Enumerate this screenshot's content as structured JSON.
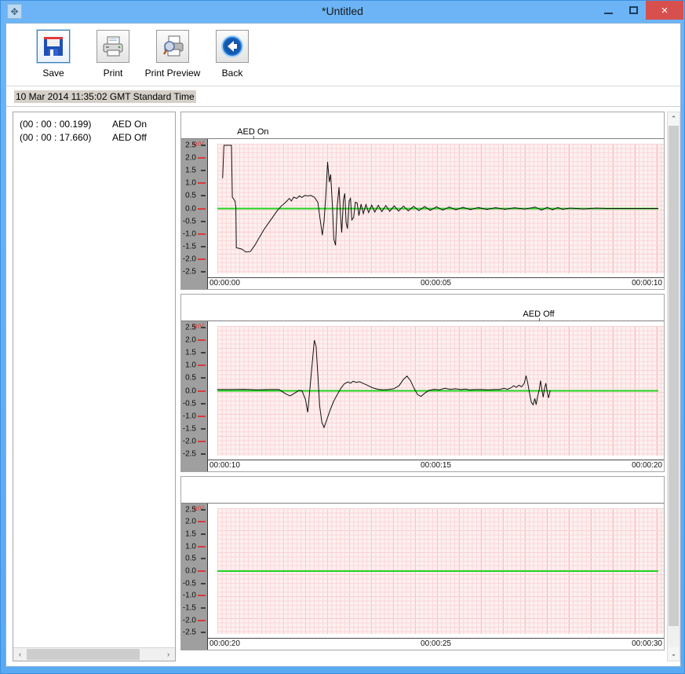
{
  "window": {
    "title": "*Untitled",
    "app_icon": "app-icon",
    "minimize_label": "Minimize",
    "maximize_label": "Maximize",
    "close_label": "×"
  },
  "toolbar": {
    "buttons": [
      {
        "label": "Save",
        "icon": "floppy-disk-icon",
        "selected": true
      },
      {
        "label": "Print",
        "icon": "printer-icon",
        "selected": false
      },
      {
        "label": "Print Preview",
        "icon": "print-preview-icon",
        "selected": false
      },
      {
        "label": "Back",
        "icon": "back-arrow-icon",
        "selected": false
      }
    ]
  },
  "recording": {
    "datetime": "10 Mar 2014 11:35:02 GMT Standard Time"
  },
  "events": [
    {
      "time": "(00 : 00 : 00.199)",
      "label": "AED On"
    },
    {
      "time": "(00 : 00 : 17.660)",
      "label": "AED Off"
    }
  ],
  "scrollbars": {
    "left_arrow": "‹",
    "right_arrow": "›",
    "up_arrow": "⌃",
    "down_arrow": "⌄"
  },
  "colors": {
    "grid_minor": "#fbd5d5",
    "grid_major": "#f4a9a9",
    "grid_bg": "#fdf0f0",
    "baseline": "#22d422",
    "trace": "#111111",
    "axis_unit": "#d83a3a",
    "titlebar": "#6cb4f5",
    "close_button": "#d8504d"
  },
  "chart_data": [
    {
      "type": "line",
      "title": "",
      "annotation": {
        "text": "AED On",
        "x_fraction": 0.105
      },
      "ylabel": "mV",
      "ylim": [
        -2.75,
        2.75
      ],
      "yticks": [
        2.5,
        2.0,
        1.5,
        1.0,
        0.5,
        0.0,
        -0.5,
        -1.0,
        -1.5,
        -2.0,
        -2.5
      ],
      "ytick_labels": [
        "2.5",
        "2.0",
        "1.5",
        "1.0",
        "0.5",
        "0.0",
        "-0.5",
        "-1.0",
        "-1.5",
        "-2.0",
        "-2.5"
      ],
      "xlabel": "",
      "xlim": [
        0,
        10
      ],
      "xtick_labels": [
        "00:00:00",
        "00:00:05",
        "00:00:10"
      ],
      "grid": true,
      "baseline": 0.0,
      "trace_start_fraction": 0.012,
      "trace_end_fraction": 1.0,
      "description": "Defibrillation artifact: saturated square pulse, deep negative deflection, recovery, then large biphasic spike with damped ringing decaying to flat baseline",
      "points": [
        [
          0.012,
          1.2
        ],
        [
          0.015,
          2.5
        ],
        [
          0.03,
          2.5
        ],
        [
          0.032,
          2.5
        ],
        [
          0.034,
          0.45
        ],
        [
          0.04,
          0.3
        ],
        [
          0.042,
          0.05
        ],
        [
          0.043,
          -1.55
        ],
        [
          0.055,
          -1.6
        ],
        [
          0.065,
          -1.72
        ],
        [
          0.075,
          -1.7
        ],
        [
          0.085,
          -1.45
        ],
        [
          0.095,
          -1.15
        ],
        [
          0.105,
          -0.85
        ],
        [
          0.115,
          -0.6
        ],
        [
          0.125,
          -0.35
        ],
        [
          0.135,
          -0.1
        ],
        [
          0.145,
          0.1
        ],
        [
          0.155,
          0.25
        ],
        [
          0.163,
          0.4
        ],
        [
          0.168,
          0.3
        ],
        [
          0.173,
          0.45
        ],
        [
          0.18,
          0.4
        ],
        [
          0.186,
          0.5
        ],
        [
          0.192,
          0.44
        ],
        [
          0.198,
          0.52
        ],
        [
          0.205,
          0.5
        ],
        [
          0.212,
          0.52
        ],
        [
          0.22,
          0.45
        ],
        [
          0.228,
          0.25
        ],
        [
          0.233,
          -0.4
        ],
        [
          0.238,
          -1.05
        ],
        [
          0.242,
          -0.5
        ],
        [
          0.246,
          0.55
        ],
        [
          0.25,
          1.85
        ],
        [
          0.254,
          1.05
        ],
        [
          0.257,
          1.35
        ],
        [
          0.261,
          0.1
        ],
        [
          0.264,
          -1.2
        ],
        [
          0.268,
          -1.45
        ],
        [
          0.272,
          0.15
        ],
        [
          0.276,
          0.85
        ],
        [
          0.279,
          -0.2
        ],
        [
          0.282,
          -0.95
        ],
        [
          0.286,
          0.35
        ],
        [
          0.289,
          0.6
        ],
        [
          0.292,
          -0.55
        ],
        [
          0.295,
          -0.8
        ],
        [
          0.299,
          0.3
        ],
        [
          0.302,
          0.4
        ],
        [
          0.305,
          -0.45
        ],
        [
          0.309,
          -0.35
        ],
        [
          0.313,
          0.25
        ],
        [
          0.317,
          0.22
        ],
        [
          0.321,
          -0.28
        ],
        [
          0.326,
          0.18
        ],
        [
          0.331,
          -0.2
        ],
        [
          0.337,
          0.16
        ],
        [
          0.343,
          -0.16
        ],
        [
          0.35,
          0.14
        ],
        [
          0.357,
          -0.14
        ],
        [
          0.365,
          0.13
        ],
        [
          0.373,
          -0.12
        ],
        [
          0.382,
          0.12
        ],
        [
          0.391,
          -0.11
        ],
        [
          0.401,
          0.11
        ],
        [
          0.411,
          -0.1
        ],
        [
          0.422,
          0.1
        ],
        [
          0.433,
          -0.09
        ],
        [
          0.445,
          0.09
        ],
        [
          0.457,
          -0.08
        ],
        [
          0.47,
          0.08
        ],
        [
          0.483,
          -0.07
        ],
        [
          0.497,
          0.07
        ],
        [
          0.511,
          -0.06
        ],
        [
          0.526,
          0.06
        ],
        [
          0.541,
          -0.05
        ],
        [
          0.557,
          0.05
        ],
        [
          0.574,
          -0.04
        ],
        [
          0.592,
          0.04
        ],
        [
          0.611,
          -0.035
        ],
        [
          0.631,
          0.035
        ],
        [
          0.652,
          -0.03
        ],
        [
          0.674,
          0.03
        ],
        [
          0.697,
          -0.025
        ],
        [
          0.721,
          0.06
        ],
        [
          0.735,
          -0.06
        ],
        [
          0.748,
          0.05
        ],
        [
          0.76,
          -0.05
        ],
        [
          0.772,
          0.04
        ],
        [
          0.783,
          -0.03
        ],
        [
          0.8,
          0.02
        ],
        [
          0.83,
          -0.02
        ],
        [
          0.86,
          0.02
        ],
        [
          0.885,
          0.0
        ],
        [
          0.91,
          0.0
        ],
        [
          0.95,
          0.0
        ],
        [
          1.0,
          0.0
        ]
      ]
    },
    {
      "type": "line",
      "title": "",
      "annotation": {
        "text": "AED Off",
        "x_fraction": 0.772
      },
      "ylabel": "mV",
      "ylim": [
        -2.75,
        2.75
      ],
      "yticks": [
        2.5,
        2.0,
        1.5,
        1.0,
        0.5,
        0.0,
        -0.5,
        -1.0,
        -1.5,
        -2.0,
        -2.5
      ],
      "ytick_labels": [
        "2.5",
        "2.0",
        "1.5",
        "1.0",
        "0.5",
        "0.0",
        "-0.5",
        "-1.0",
        "-1.5",
        "-2.0",
        "-2.5"
      ],
      "xlabel": "",
      "xlim": [
        10,
        20
      ],
      "xtick_labels": [
        "00:00:10",
        "00:00:15",
        "00:00:20"
      ],
      "grid": true,
      "baseline": 0.0,
      "trace_start_fraction": 0.0,
      "trace_end_fraction": 0.755,
      "description": "Quiet baseline then a large QRS complex with tall R wave and deep S wave, followed by low-amplitude noisy activity that ends mid-panel",
      "points": [
        [
          0.0,
          0.05
        ],
        [
          0.03,
          0.05
        ],
        [
          0.06,
          0.06
        ],
        [
          0.09,
          0.04
        ],
        [
          0.12,
          0.05
        ],
        [
          0.14,
          0.05
        ],
        [
          0.155,
          -0.12
        ],
        [
          0.165,
          -0.2
        ],
        [
          0.175,
          -0.1
        ],
        [
          0.185,
          0.02
        ],
        [
          0.192,
          0.0
        ],
        [
          0.2,
          -0.35
        ],
        [
          0.205,
          -0.85
        ],
        [
          0.21,
          0.1
        ],
        [
          0.215,
          1.05
        ],
        [
          0.22,
          2.0
        ],
        [
          0.224,
          1.75
        ],
        [
          0.228,
          0.6
        ],
        [
          0.232,
          -0.6
        ],
        [
          0.237,
          -1.25
        ],
        [
          0.242,
          -1.45
        ],
        [
          0.248,
          -1.15
        ],
        [
          0.256,
          -0.75
        ],
        [
          0.264,
          -0.4
        ],
        [
          0.272,
          -0.15
        ],
        [
          0.28,
          0.1
        ],
        [
          0.288,
          0.28
        ],
        [
          0.296,
          0.35
        ],
        [
          0.302,
          0.3
        ],
        [
          0.308,
          0.38
        ],
        [
          0.315,
          0.33
        ],
        [
          0.322,
          0.36
        ],
        [
          0.33,
          0.3
        ],
        [
          0.34,
          0.22
        ],
        [
          0.352,
          0.12
        ],
        [
          0.364,
          0.06
        ],
        [
          0.376,
          0.04
        ],
        [
          0.388,
          0.05
        ],
        [
          0.4,
          0.08
        ],
        [
          0.412,
          0.2
        ],
        [
          0.422,
          0.45
        ],
        [
          0.43,
          0.58
        ],
        [
          0.438,
          0.4
        ],
        [
          0.446,
          0.1
        ],
        [
          0.454,
          -0.15
        ],
        [
          0.462,
          -0.22
        ],
        [
          0.47,
          -0.1
        ],
        [
          0.48,
          0.02
        ],
        [
          0.492,
          0.06
        ],
        [
          0.504,
          0.04
        ],
        [
          0.516,
          0.1
        ],
        [
          0.528,
          0.06
        ],
        [
          0.54,
          0.08
        ],
        [
          0.552,
          0.05
        ],
        [
          0.562,
          0.07
        ],
        [
          0.572,
          0.04
        ],
        [
          0.585,
          0.05
        ],
        [
          0.6,
          0.05
        ],
        [
          0.615,
          0.04
        ],
        [
          0.628,
          0.05
        ],
        [
          0.64,
          0.05
        ],
        [
          0.65,
          0.1
        ],
        [
          0.658,
          0.06
        ],
        [
          0.666,
          0.12
        ],
        [
          0.672,
          0.2
        ],
        [
          0.678,
          0.14
        ],
        [
          0.684,
          0.22
        ],
        [
          0.69,
          0.16
        ],
        [
          0.696,
          0.3
        ],
        [
          0.7,
          0.6
        ],
        [
          0.704,
          0.3
        ],
        [
          0.708,
          -0.1
        ],
        [
          0.712,
          -0.45
        ],
        [
          0.716,
          -0.55
        ],
        [
          0.72,
          -0.3
        ],
        [
          0.723,
          -0.55
        ],
        [
          0.726,
          -0.25
        ],
        [
          0.73,
          0.05
        ],
        [
          0.733,
          0.4
        ],
        [
          0.736,
          0.05
        ],
        [
          0.739,
          -0.25
        ],
        [
          0.742,
          0.1
        ],
        [
          0.745,
          0.3
        ],
        [
          0.748,
          -0.05
        ],
        [
          0.751,
          -0.28
        ],
        [
          0.755,
          0.02
        ]
      ]
    },
    {
      "type": "line",
      "title": "",
      "annotation": null,
      "ylabel": "mV",
      "ylim": [
        -2.75,
        2.75
      ],
      "yticks": [
        2.5,
        2.0,
        1.5,
        1.0,
        0.5,
        0.0,
        -0.5,
        -1.0,
        -1.5,
        -2.0,
        -2.5
      ],
      "ytick_labels": [
        "2.5",
        "2.0",
        "1.5",
        "1.0",
        "0.5",
        "0.0",
        "-0.5",
        "-1.0",
        "-1.5",
        "-2.0",
        "-2.5"
      ],
      "xlabel": "",
      "xlim": [
        20,
        30
      ],
      "xtick_labels": [
        "00:00:20",
        "00:00:25",
        "00:00:30"
      ],
      "grid": true,
      "baseline": 0.0,
      "trace_start_fraction": 0.0,
      "trace_end_fraction": 0.0,
      "description": "Empty panel: no ECG trace recorded, only the green zero baseline over graph paper",
      "points": []
    }
  ]
}
